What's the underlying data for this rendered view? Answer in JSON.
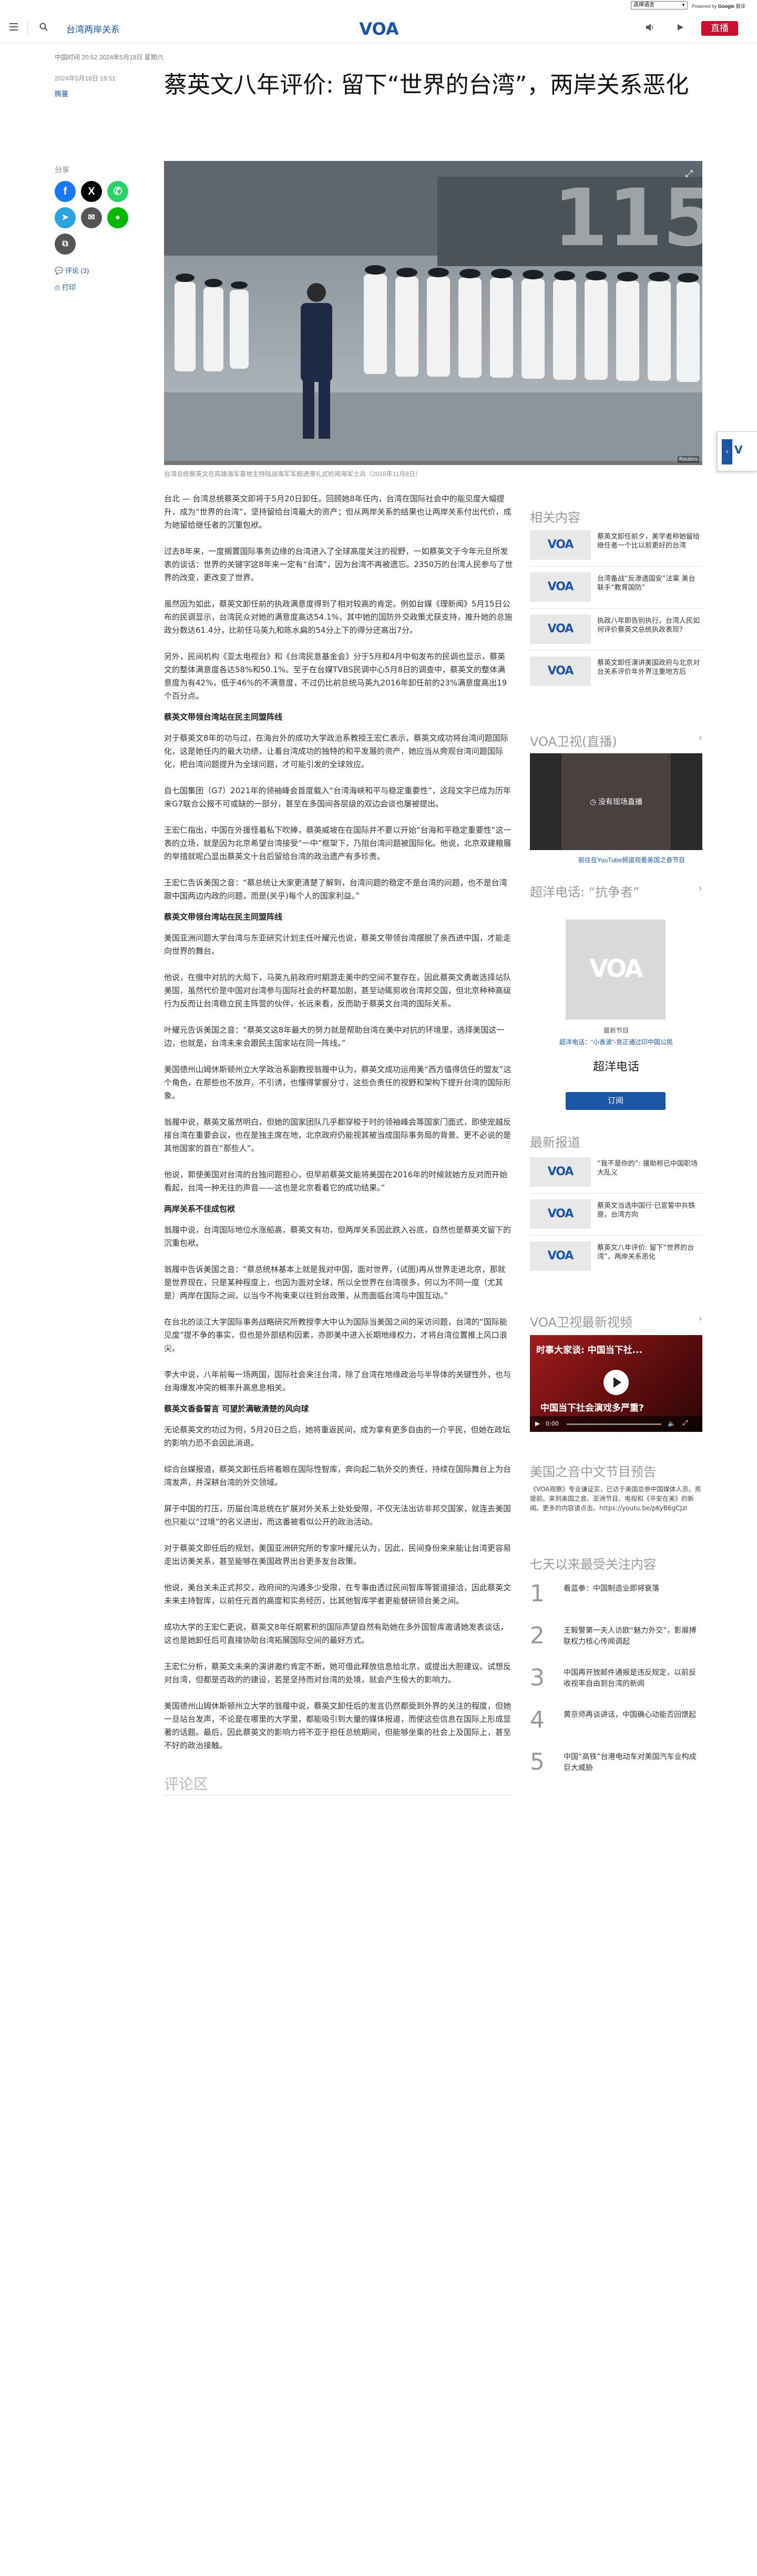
{
  "translate": {
    "select_label": "选择语言",
    "powered_by": "Powered by",
    "brand": "Google",
    "service": "翻译"
  },
  "header": {
    "section": "台湾两岸关系",
    "logo": "VOA",
    "live_button": "直播"
  },
  "article": {
    "dateline": "中国时间 20:52 2024年5月18日 星期六",
    "published": "2024年5月18日 19:51",
    "byline": "腾蔓",
    "title": "蔡英文八年评价: 留下“世界的台湾”，两岸关系恶化",
    "image_caption": "台湾总统蔡英文在高雄海军基地主持陆战海军军舰进港礼式检阅海军士兵（2016年11月8日）",
    "image_credit": "Reuters",
    "share_label": "分享",
    "comments_link": "评论 (3)",
    "print_link": "打印",
    "paragraphs": [
      "台北 — 台湾总统蔡英文即将于5月20日卸任。回顾她8年任内，台湾在国际社会中的能见度大幅提升，成为“世界的台湾”，坚持留给台湾最大的资产；但从两岸关系的结果也让两岸关系付出代价，成为她留给继任者的沉重包袱。",
      "过去8年来，一度搁置国际事务边缘的台湾进入了全球高度关注的视野，一如蔡英文于今年元旦所发表的谈话：世界的关键字这8年来一定有“台湾”，因为台湾不再被遗忘。2350万的台湾人民参与了世界的改变，更改变了世界。",
      "虽然因为如此，蔡英文卸任前的执政满意度得到了相对较高的肯定。例如台媒《理新闻》5月15日公布的民调显示，台湾民众对她的满意度高达54.1%，其中她的国防外交政策尤获支持，推升她的总施政分数达61.4分，比前任马英九和陈水扁的54分上下的得分还高出7分。",
      "另外，民间机构《亚太电视台》和《台湾民意基金会》分于5月和4月中旬发布的民调也显示，蔡英文的整体满意度各达58%和50.1%。至于在台媒TVBS民调中心5月8日的调查中，蔡英文的整体满意度为有42%，低于46%的不满意度，不过仍比前总统马英九2016年卸任前的23%满意度高出19个百分点。",
      "对于蔡英文8年的功与过，在海台外的成功大学政治系教授王宏仁表示，蔡英文成功将台湾问题国际化，这是她任内的最大功绩，让着台湾成功的独特的和平发展的资产，她应当从旁观台湾问题国际化，把台湾问题提升为全球问题，才可能引发的全球效应。",
      "自七国集团（G7）2021年的领袖峰会首度载入“台湾海峡和平与稳定重要性”，这段文字已成为历年来G7联合公报不可或缺的一部分，甚至在多国间各层级的双边会谈也屡被提出。",
      "王宏仁指出，中国在外援怪着私下吹捧，蔡英威坡在在国际并不要以开始“台海和平稳定重要性”这一表的立场，就是因为北京希望台湾接受“一中”框架下，乃阻台湾问题被国际化。他说，北京双建粮展的举措就呢凸显出蔡英文十台后留给台湾的政治遗产有多珍贵。",
      "王宏仁告诉美国之音：“蔡总统让大家更清楚了解到，台湾问题的稳定不是台湾的问题，也不是台湾跟中国两边内政的问题，而是(关乎)每个人的国家利益。”"
    ],
    "h1": "蔡英文带领台湾站在民主同盟阵线",
    "paragraphs2": [
      "美国亚洲问题大学台湾与东亚研究计划主任叶耀元也说，蔡英文带领台湾摆脱了亲西进中国，才能走向世界的舞台。",
      "他说，在俄中对抗的大局下，马英九前政府时期游走美中的空间不复存在，因此蔡英文勇敢选择站队美国，虽然代价是中国对台湾参与国际社会的杯葛加剧，甚至动辄剪收台湾邦交国，但北京种种高级行为反而让台湾稳立民主阵营的伙伴，长远来看，反而助于蔡英文台湾的国际关系。",
      "叶耀元告诉美国之音：“蔡英文这8年最大的努力就是帮助台湾在美中对抗的环境里，选择美国这一边，也就是，台湾未来会跟民主国家站在同一阵线。”",
      "美国德州山姆休斯顿州立大学政治系副教授翁履中认为，蔡英文成功运用美“西方值得信任的盟友”这个角色，在那些也不放弃，不引诱，也懂得掌握分寸，这些负责任的视野和架构下提升台湾的国际形象。",
      "翁履中说，蔡英文虽然明白，但她的国家团队几乎都穿梭于时的领袖峰会等国家门面式，即使宠越反接台湾在重要会议，也在是独主席在地，北京政府仍能视其被当成国际事务局的背景、更不必说的是其他国家的首在“那些人”。",
      "他说，郭使美国对台湾的台独问题担心，但早前蔡英文能将美国在2016年的时候就她方反对而开始看起，台湾一种无往的声音——这也是北京看着它的成功结果。”"
    ],
    "h2": "两岸关系不佳成包袱",
    "paragraphs3": [
      "翁履中说，台湾国际地位水涨船高，蔡英文有功，但两岸关系因此跌入谷底，自然也是蔡英文留下的沉重包袱。",
      "翁履中告诉美国之音：“蔡总统林基本上就是我对中国，面对世界，(试图)再从世界走进北京，那就是世界现在，只是某种程度上，也因为面对全球，所以全世界在台湾很多，何以为不同一度（尤其是）两岸在国际之间，以当今不拘束束以往到台政策，从而面临台湾与中国互动。”",
      "在台北的淡江大学国际事务战略研究所教授李大中认为国际当美国之间的采访问题，台湾的“国际能见度”提不争的事实，但也是外部结构因素，亦即美中进入长期地缘权力，才将台湾位置推上风口浪尖。",
      "李大中说，八年前每一场两国，国际社会来注台湾，除了台湾在地缘政治与半导体的关键性外，也与台海爆发冲突的概率升高息息相关。"
    ],
    "h3": "蔡英文香备誓言 可望於满敏清楚的风向球",
    "paragraphs4": [
      "无论蔡英文的功过为何，5月20日之后，她将重返民间，成为拿有更多自由的一介平民，但她在政坛的影响力恐不会因此消退。",
      "综合台媒报道，蔡英文卸任后将着眼在国际性智库，奔向起二轨外交的责任，持续在国际舞台上为台湾发声，并深耕台湾的外交领域。",
      "屏于中国的打压，历届台湾总统在扩展对外关系上处处受限，不仅无法出访非邦交国家，就连去美国也只能以“过境”的名义进出，而这番被看似公开的政治活动。",
      "对于蔡英文即任后的规划，美国亚洲研究所的专家叶耀元认为，因此，民间身份来来能让台湾更容易走出访美关系，甚至能够在美国政界出台更多友台政策。",
      "他说，美台关未正式邦交，政府间的沟通多少受限，在专事由透过民间智库等管道接洽，因此蔡英文未来主持智库，以前任元首的高度和实务经历，比其他智库学者更能替研领台美之间。",
      "成功大学的王宏仁更说，蔡英文8年任期累积的国际声望自然有助她在多外国智库邀请她发表谈话，这也是她卸任后可直接协助台湾拓展国际空间的最好方式。",
      "王宏仁分析，蔡英文未来的演讲邀约肯定不断，她可借此释放信息给北京，或提出大胆建议。试想反对台湾，但都是否政的的建设，若是坚持而对台湾的处境，就会产生极大的影响力。",
      "美国德州山姆休斯顿州立大学的翁履中说，蔡英文卸任后的发言仍然都受到外界的关注的程度，但她一旦站台发声，不论是在哪里的大学里，都能吸引到大量的媒体报道，而使这些信息在国际上形成显著的话题。最后，因此蔡英文的影响力将不亚于担任总统期间，但能够坐乘的社会上及国际上，甚至不好的政治接触。"
    ],
    "comments_heading": "评论区"
  },
  "sidebar": {
    "related_heading": "相关内容",
    "related": [
      {
        "thumb": "VOA",
        "text": "蔡英文卸任前夕，美学者称她留给继任者一个比以前更好的台湾"
      },
      {
        "thumb": "VOA",
        "text": "台湾备战“反渗透国安”法案 美台联手“教育国防”"
      },
      {
        "thumb": "VOA",
        "text": "执政八年即告别执行，台湾人民如何评价蔡英文总统执政表现？"
      },
      {
        "thumb": "VOA",
        "text": "蔡英文卸任演讲美国政府与北京对台关系评价年外界注重地方后"
      }
    ],
    "tv_heading": "VOA卫视(直播)",
    "tv_notice": "没有现场直播",
    "tv_caption": "前往在YouTube频道观看美国之音节目",
    "podcast_heading": "超洋电话: “抗争者”",
    "podcast_logo": "VOA",
    "podcast_label": "最新节目",
    "podcast_link": "超洋电话：“小香波”-竞正通过印中国公民",
    "podcast_name": "超洋电话",
    "subscribe": "订阅",
    "latest_heading": "最新报道",
    "latest": [
      {
        "thumb": "VOA",
        "text": "“我不是你的”: 援助称已中国职场大乱义"
      },
      {
        "thumb": "VOA",
        "text": "蔡英文当选中国行·已宣誓中共铁原，台湾方向"
      },
      {
        "thumb": "VOA",
        "text": "蔡英文八年评价: 留下“世界的台湾”，两岸关系恶化"
      }
    ],
    "video_heading": "VOA卫视最新视频",
    "video_top_text": "时事大家谈: 中国当下社...",
    "video_overlay": "中国当下社会演戏多严重?",
    "video_time": "0:00",
    "podcast2_heading": "美国之音中文节目预告",
    "podcast2_text": "《VOA观察》专业谦证实，已访于美国总参中国媒体人员。亮提前。来到美国之音、亚洲节目、电视和《平安在美》的新闻。更多的内容请点击。https://youtu.be/pKyB6gCJzI",
    "most_heading": "七天以来最受关注内容",
    "most": [
      {
        "num": "1",
        "text": "看蓝拳：中国制造业即将衰落"
      },
      {
        "num": "2",
        "text": "王毅警第一夫人访欧“魅力外交”，影展搏联权力核心传闻调起"
      },
      {
        "num": "3",
        "text": "中国再开放邮件通报是违反规定，以前反收视率自由到台湾的新闻"
      },
      {
        "num": "4",
        "text": "黄京师再谈讲话，中国确心动能否回馈起"
      },
      {
        "num": "5",
        "text": "中国“高铁”台港电动车对美国汽车业构成巨大威胁"
      }
    ]
  },
  "colors": {
    "brand_blue": "#1a56a6",
    "live_red": "#c8102e"
  }
}
